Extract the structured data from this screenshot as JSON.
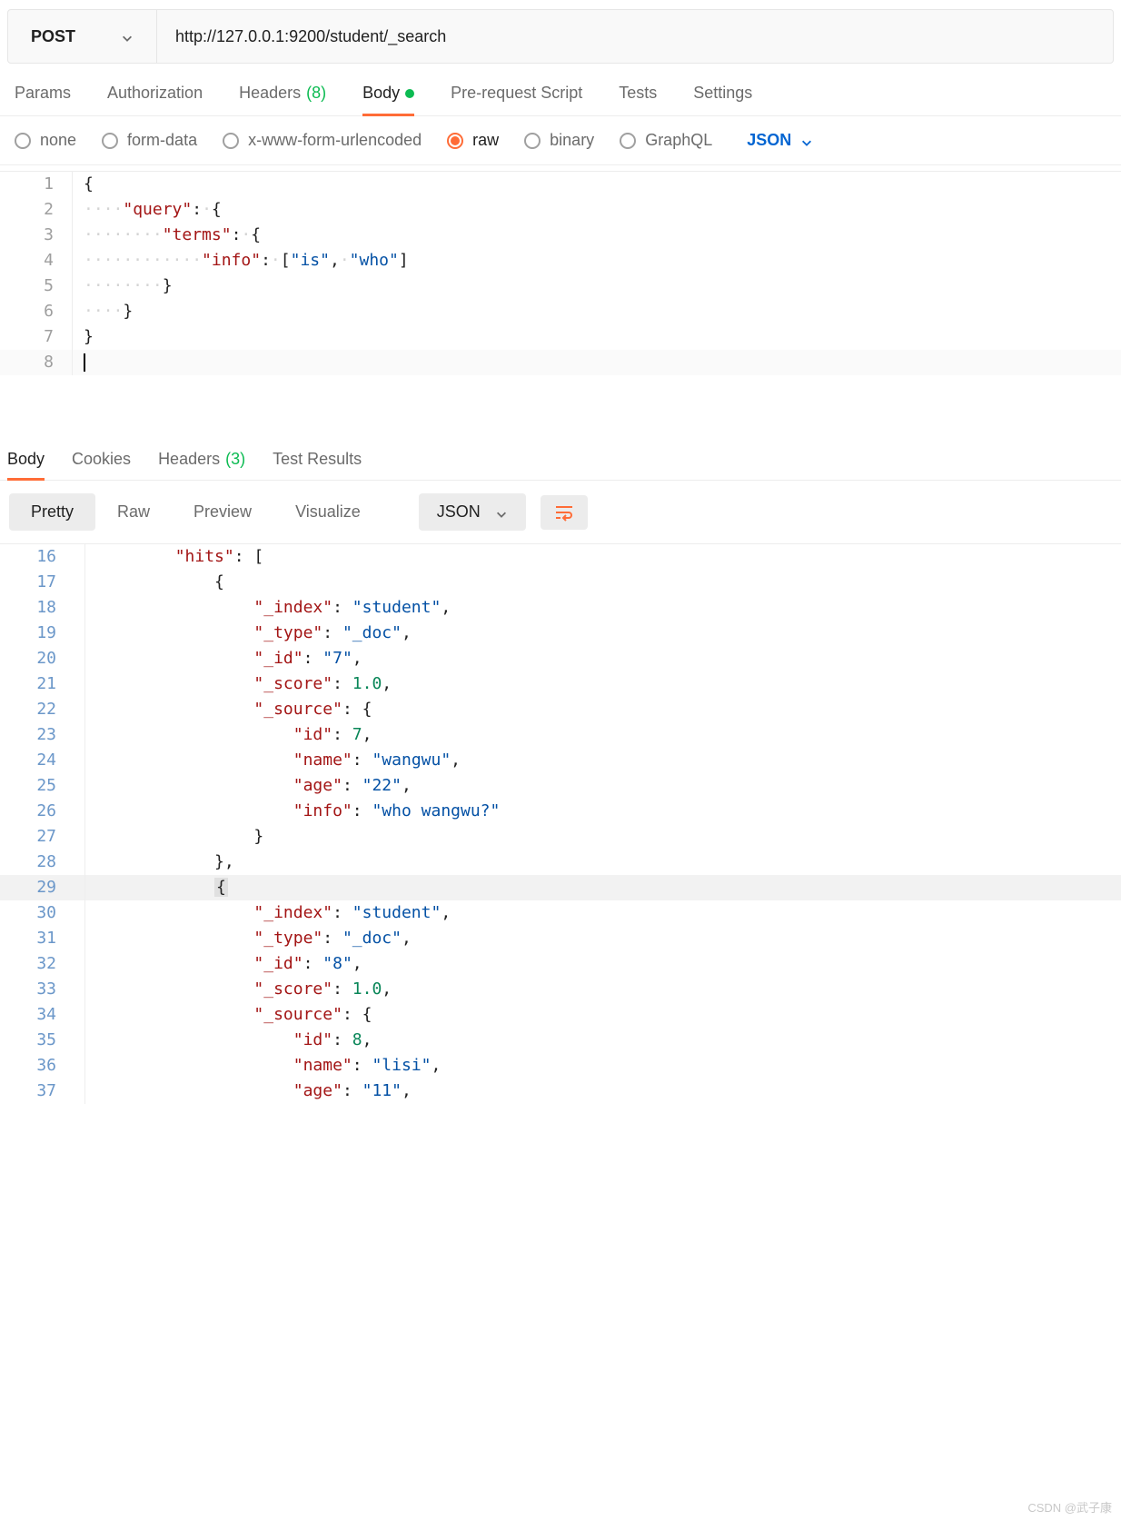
{
  "request": {
    "method": "POST",
    "url": "http://127.0.0.1:9200/student/_search"
  },
  "mainTabs": {
    "params": "Params",
    "auth": "Authorization",
    "headers": "Headers",
    "headersCount": "(8)",
    "body": "Body",
    "prereq": "Pre-request Script",
    "tests": "Tests",
    "settings": "Settings"
  },
  "bodyTypes": {
    "none": "none",
    "formdata": "form-data",
    "urlencoded": "x-www-form-urlencoded",
    "raw": "raw",
    "binary": "binary",
    "graphql": "GraphQL",
    "format": "JSON"
  },
  "requestBody": {
    "l1": "{",
    "l2_key": "\"query\"",
    "l3_key": "\"terms\"",
    "l4_key": "\"info\"",
    "l4_v1": "\"is\"",
    "l4_v2": "\"who\"",
    "l5": "}",
    "l6": "}",
    "l7": "}"
  },
  "responseTabs": {
    "body": "Body",
    "cookies": "Cookies",
    "headers": "Headers",
    "headersCount": "(3)",
    "testResults": "Test Results"
  },
  "viewModes": {
    "pretty": "Pretty",
    "raw": "Raw",
    "preview": "Preview",
    "visualize": "Visualize",
    "format": "JSON"
  },
  "response": {
    "lines": [
      {
        "n": 16,
        "indent": 2,
        "parts": [
          {
            "t": "key",
            "v": "\"hits\""
          },
          {
            "t": "p",
            "v": ": ["
          }
        ]
      },
      {
        "n": 17,
        "indent": 3,
        "parts": [
          {
            "t": "p",
            "v": "{"
          }
        ]
      },
      {
        "n": 18,
        "indent": 4,
        "parts": [
          {
            "t": "key",
            "v": "\"_index\""
          },
          {
            "t": "p",
            "v": ": "
          },
          {
            "t": "str",
            "v": "\"student\""
          },
          {
            "t": "p",
            "v": ","
          }
        ]
      },
      {
        "n": 19,
        "indent": 4,
        "parts": [
          {
            "t": "key",
            "v": "\"_type\""
          },
          {
            "t": "p",
            "v": ": "
          },
          {
            "t": "str",
            "v": "\"_doc\""
          },
          {
            "t": "p",
            "v": ","
          }
        ]
      },
      {
        "n": 20,
        "indent": 4,
        "parts": [
          {
            "t": "key",
            "v": "\"_id\""
          },
          {
            "t": "p",
            "v": ": "
          },
          {
            "t": "str",
            "v": "\"7\""
          },
          {
            "t": "p",
            "v": ","
          }
        ]
      },
      {
        "n": 21,
        "indent": 4,
        "parts": [
          {
            "t": "key",
            "v": "\"_score\""
          },
          {
            "t": "p",
            "v": ": "
          },
          {
            "t": "num",
            "v": "1.0"
          },
          {
            "t": "p",
            "v": ","
          }
        ]
      },
      {
        "n": 22,
        "indent": 4,
        "parts": [
          {
            "t": "key",
            "v": "\"_source\""
          },
          {
            "t": "p",
            "v": ": {"
          }
        ]
      },
      {
        "n": 23,
        "indent": 5,
        "parts": [
          {
            "t": "key",
            "v": "\"id\""
          },
          {
            "t": "p",
            "v": ": "
          },
          {
            "t": "num",
            "v": "7"
          },
          {
            "t": "p",
            "v": ","
          }
        ]
      },
      {
        "n": 24,
        "indent": 5,
        "parts": [
          {
            "t": "key",
            "v": "\"name\""
          },
          {
            "t": "p",
            "v": ": "
          },
          {
            "t": "str",
            "v": "\"wangwu\""
          },
          {
            "t": "p",
            "v": ","
          }
        ]
      },
      {
        "n": 25,
        "indent": 5,
        "parts": [
          {
            "t": "key",
            "v": "\"age\""
          },
          {
            "t": "p",
            "v": ": "
          },
          {
            "t": "str",
            "v": "\"22\""
          },
          {
            "t": "p",
            "v": ","
          }
        ]
      },
      {
        "n": 26,
        "indent": 5,
        "parts": [
          {
            "t": "key",
            "v": "\"info\""
          },
          {
            "t": "p",
            "v": ": "
          },
          {
            "t": "str",
            "v": "\"who wangwu?\""
          }
        ]
      },
      {
        "n": 27,
        "indent": 4,
        "parts": [
          {
            "t": "p",
            "v": "}"
          }
        ]
      },
      {
        "n": 28,
        "indent": 3,
        "parts": [
          {
            "t": "p",
            "v": "},"
          }
        ]
      },
      {
        "n": 29,
        "indent": 3,
        "hl": true,
        "parts": [
          {
            "t": "hlp",
            "v": "{"
          }
        ]
      },
      {
        "n": 30,
        "indent": 4,
        "parts": [
          {
            "t": "key",
            "v": "\"_index\""
          },
          {
            "t": "p",
            "v": ": "
          },
          {
            "t": "str",
            "v": "\"student\""
          },
          {
            "t": "p",
            "v": ","
          }
        ]
      },
      {
        "n": 31,
        "indent": 4,
        "parts": [
          {
            "t": "key",
            "v": "\"_type\""
          },
          {
            "t": "p",
            "v": ": "
          },
          {
            "t": "str",
            "v": "\"_doc\""
          },
          {
            "t": "p",
            "v": ","
          }
        ]
      },
      {
        "n": 32,
        "indent": 4,
        "parts": [
          {
            "t": "key",
            "v": "\"_id\""
          },
          {
            "t": "p",
            "v": ": "
          },
          {
            "t": "str",
            "v": "\"8\""
          },
          {
            "t": "p",
            "v": ","
          }
        ]
      },
      {
        "n": 33,
        "indent": 4,
        "parts": [
          {
            "t": "key",
            "v": "\"_score\""
          },
          {
            "t": "p",
            "v": ": "
          },
          {
            "t": "num",
            "v": "1.0"
          },
          {
            "t": "p",
            "v": ","
          }
        ]
      },
      {
        "n": 34,
        "indent": 4,
        "parts": [
          {
            "t": "key",
            "v": "\"_source\""
          },
          {
            "t": "p",
            "v": ": {"
          }
        ]
      },
      {
        "n": 35,
        "indent": 5,
        "parts": [
          {
            "t": "key",
            "v": "\"id\""
          },
          {
            "t": "p",
            "v": ": "
          },
          {
            "t": "num",
            "v": "8"
          },
          {
            "t": "p",
            "v": ","
          }
        ]
      },
      {
        "n": 36,
        "indent": 5,
        "parts": [
          {
            "t": "key",
            "v": "\"name\""
          },
          {
            "t": "p",
            "v": ": "
          },
          {
            "t": "str",
            "v": "\"lisi\""
          },
          {
            "t": "p",
            "v": ","
          }
        ]
      },
      {
        "n": 37,
        "indent": 5,
        "parts": [
          {
            "t": "key",
            "v": "\"age\""
          },
          {
            "t": "p",
            "v": ": "
          },
          {
            "t": "str",
            "v": "\"11\""
          },
          {
            "t": "p",
            "v": ","
          }
        ]
      }
    ]
  },
  "watermark": "CSDN @武子康"
}
